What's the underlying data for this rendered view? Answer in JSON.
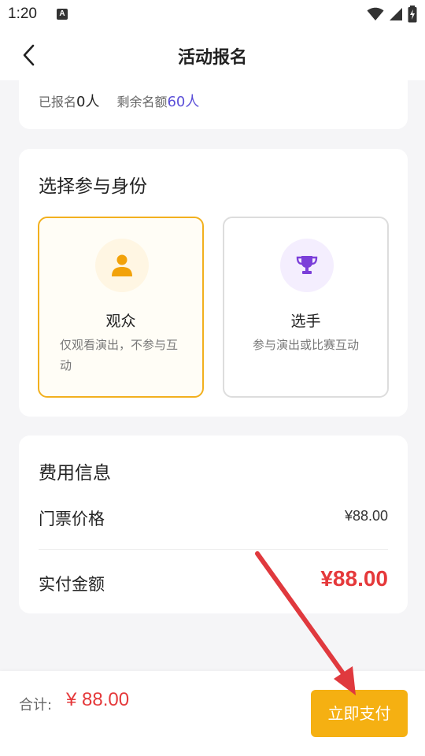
{
  "status_bar": {
    "time": "1:20",
    "notification_icon": "a-icon",
    "wifi_icon": "wifi-icon",
    "signal_icon": "signal-icon",
    "battery_icon": "battery-charging-icon"
  },
  "header": {
    "back_icon": "chevron-left-icon",
    "title": "活动报名"
  },
  "quota": {
    "registered_label": "已报名",
    "registered_count": "0人",
    "remaining_label": "剩余名额",
    "remaining_count": "60人"
  },
  "identity": {
    "title": "选择参与身份",
    "selected": "观众",
    "roles": [
      {
        "name": "观众",
        "description": "仅观看演出，不参与互动",
        "icon": "person-icon",
        "icon_color": "#f2a20a",
        "bg_color": "#fff6e3"
      },
      {
        "name": "选手",
        "description": "参与演出或比赛互动",
        "icon": "trophy-icon",
        "icon_color": "#7b3fd9",
        "bg_color": "#f4eefe"
      }
    ]
  },
  "fee": {
    "title": "费用信息",
    "ticket_label": "门票价格",
    "ticket_value": "¥88.00",
    "paid_label": "实付金额",
    "paid_value": "¥88.00"
  },
  "bottom": {
    "total_label": "合计:",
    "total_value": "¥ 88.00",
    "pay_button": "立即支付"
  },
  "colors": {
    "accent": "#f5b012",
    "price_red": "#e5393b",
    "quota_blue": "#5b4fd8",
    "annotation_arrow": "#e0393e"
  }
}
